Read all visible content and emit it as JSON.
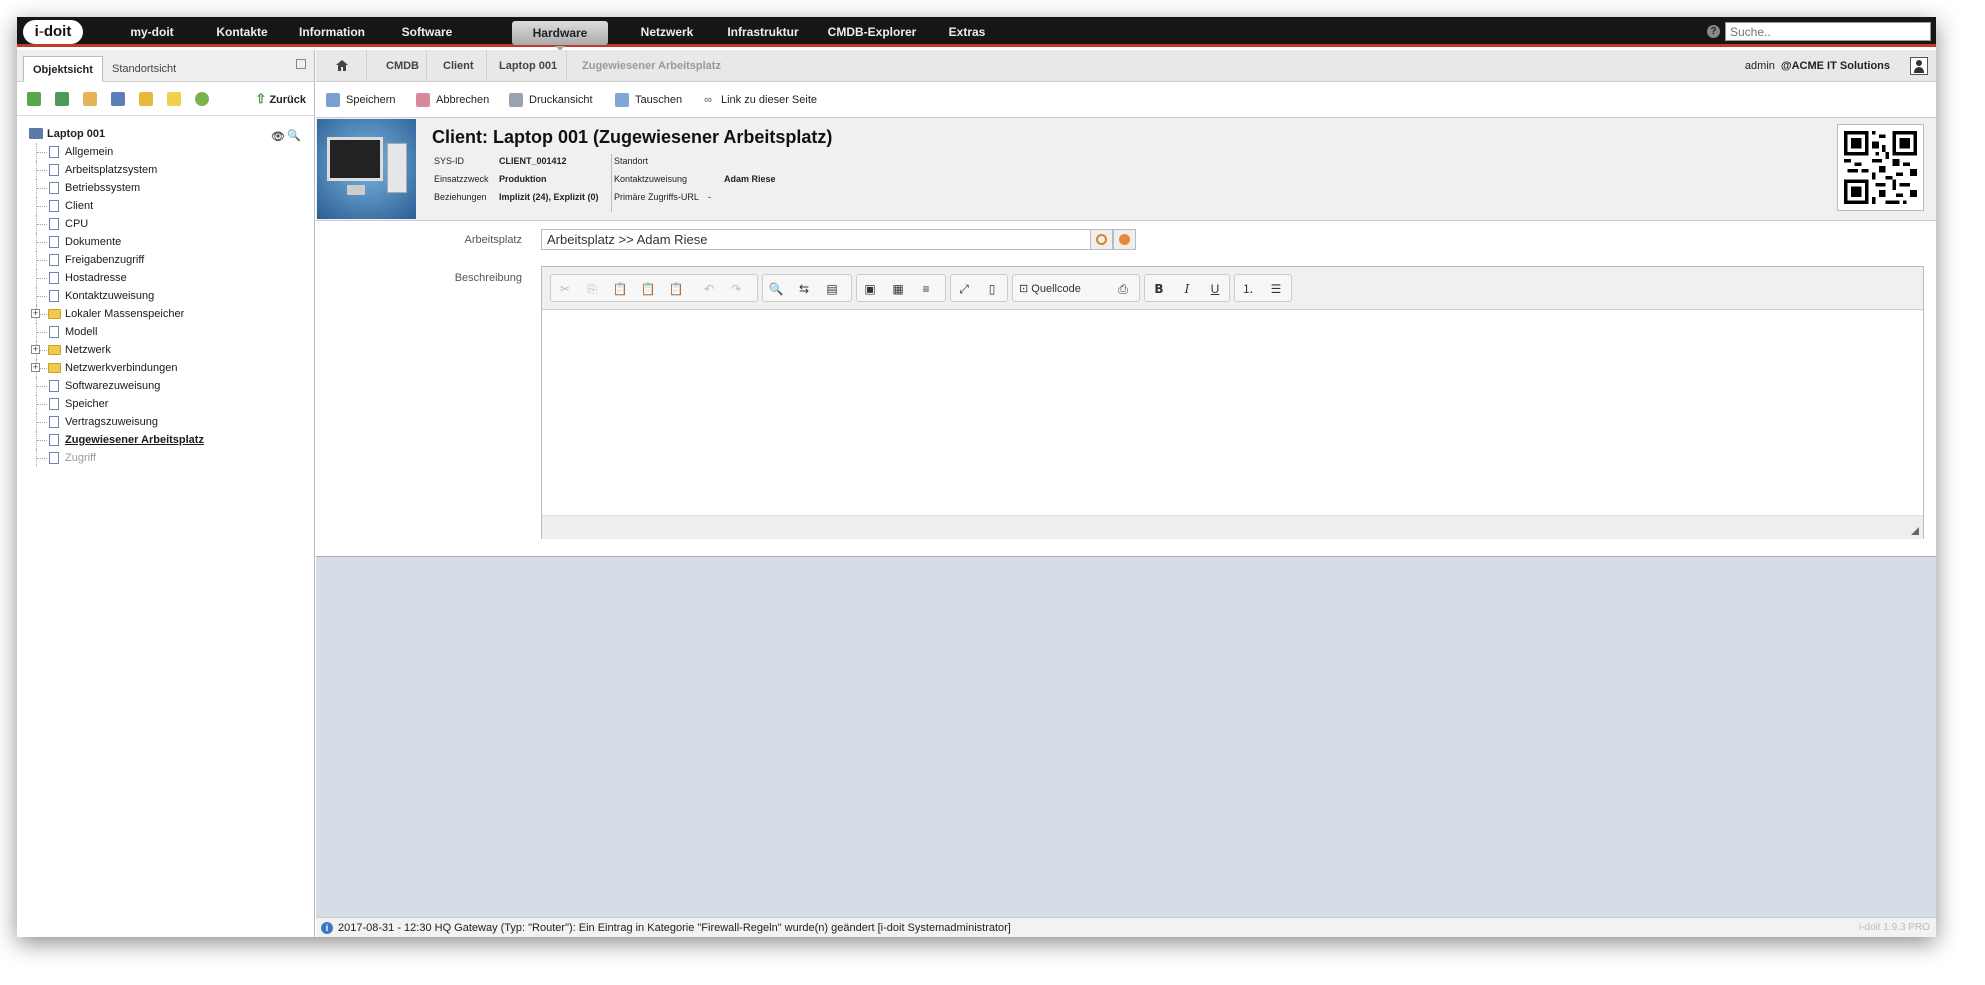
{
  "nav": {
    "logo": "i-doit",
    "items": [
      "my-doit",
      "Kontakte",
      "Information",
      "Software",
      "Hardware",
      "Netzwerk",
      "Infrastruktur",
      "CMDB-Explorer",
      "Extras"
    ],
    "active": "Hardware",
    "search_placeholder": "Suche.."
  },
  "sidebar": {
    "tabs": [
      "Objektsicht",
      "Standortsicht"
    ],
    "active_tab": "Objektsicht",
    "back_label": "Zurück",
    "tree_root": "Laptop 001",
    "items": [
      {
        "label": "Allgemein",
        "type": "doc"
      },
      {
        "label": "Arbeitsplatzsystem",
        "type": "doc"
      },
      {
        "label": "Betriebssystem",
        "type": "doc"
      },
      {
        "label": "Client",
        "type": "doc"
      },
      {
        "label": "CPU",
        "type": "doc"
      },
      {
        "label": "Dokumente",
        "type": "doc"
      },
      {
        "label": "Freigabenzugriff",
        "type": "doc"
      },
      {
        "label": "Hostadresse",
        "type": "doc"
      },
      {
        "label": "Kontaktzuweisung",
        "type": "doc"
      },
      {
        "label": "Lokaler Massenspeicher",
        "type": "folder"
      },
      {
        "label": "Modell",
        "type": "doc"
      },
      {
        "label": "Netzwerk",
        "type": "folder"
      },
      {
        "label": "Netzwerkverbindungen",
        "type": "folder"
      },
      {
        "label": "Softwarezuweisung",
        "type": "doc"
      },
      {
        "label": "Speicher",
        "type": "doc"
      },
      {
        "label": "Vertragszuweisung",
        "type": "doc"
      },
      {
        "label": "Zugewiesener Arbeitsplatz",
        "type": "doc",
        "state": "current"
      },
      {
        "label": "Zugriff",
        "type": "doc",
        "state": "disabled"
      }
    ]
  },
  "breadcrumb": [
    "CMDB",
    "Client",
    "Laptop 001",
    "Zugewiesener Arbeitsplatz"
  ],
  "user": {
    "name": "admin",
    "tenant": "@ACME IT Solutions"
  },
  "actions": [
    "Speichern",
    "Abbrechen",
    "Druckansicht",
    "Tauschen",
    "Link zu dieser Seite"
  ],
  "object": {
    "title": "Client: Laptop 001 (Zugewiesener Arbeitsplatz)",
    "sysid_label": "SYS-ID",
    "sysid": "CLIENT_001412",
    "purpose_label": "Einsatzzweck",
    "purpose": "Produktion",
    "relations_label": "Beziehungen",
    "relations": "Implizit (24), Explizit (0)",
    "location_label": "Standort",
    "location": "",
    "contact_label": "Kontaktzuweisung",
    "contact": "Adam Riese",
    "url_label": "Primäre Zugriffs-URL",
    "url": "-"
  },
  "form": {
    "arbeitsplatz_label": "Arbeitsplatz",
    "arbeitsplatz_value": "Arbeitsplatz >> Adam Riese",
    "beschreibung_label": "Beschreibung",
    "source_label": "Quellcode"
  },
  "status": {
    "message": "2017-08-31 - 12:30 HQ Gateway (Typ: \"Router\"): Ein Eintrag in Kategorie \"Firewall-Regeln\" wurde(n) geändert [i-doit Systemadministrator]",
    "version": "i-doit 1.9.3 PRO"
  },
  "colors": {
    "nav_bg": "#161616",
    "nav_accent": "#c0392b",
    "main_bg": "#d7dde6"
  }
}
